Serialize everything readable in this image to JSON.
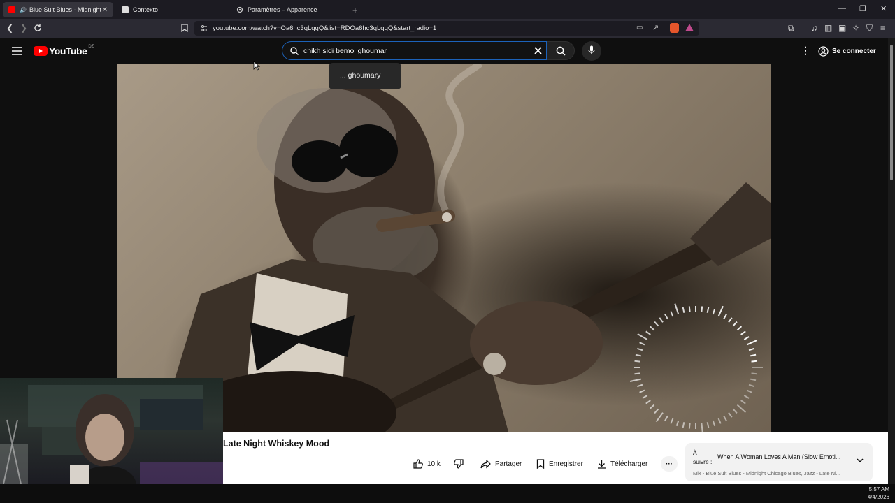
{
  "browser": {
    "tabs": [
      {
        "label": "Blue Suit Blues - Midnight Ch",
        "active": true
      },
      {
        "label": "Contexto",
        "active": false
      },
      {
        "label": "Paramètres – Apparence",
        "active": false
      }
    ],
    "new_tab": "+",
    "url": "youtube.com/watch?v=Oa6hc3qLqqQ&list=RDOa6hc3qLqqQ&start_radio=1"
  },
  "youtube": {
    "logo_text": "YouTube",
    "region": "DZ",
    "search_query": "chikh sidi bemol ghoumar",
    "suggestion": "... ghoumary",
    "signin_label": "Se connecter"
  },
  "video": {
    "title": "Late Night Whiskey Mood",
    "likes": "10 k",
    "share_label": "Partager",
    "save_label": "Enregistrer",
    "download_label": "Télécharger"
  },
  "up_next": {
    "prefix_line1": "À",
    "prefix_line2": "suivre :",
    "title": "When A Woman Loves A Man (Slow Emoti...",
    "playlist": "Mix - Blue Suit Blues - Midnight Chicago Blues, Jazz - Late Ni..."
  },
  "system": {
    "time": "5:57 AM",
    "date": "4/4/2026"
  },
  "colors": {
    "yt_red": "#ff0000",
    "search_focus": "#1c62b9",
    "accent_blue": "#3ea6ff"
  }
}
